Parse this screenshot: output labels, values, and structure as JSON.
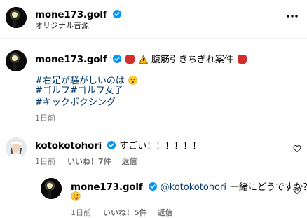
{
  "header": {
    "username": "mone173.golf",
    "audio_label": "オリジナル音源",
    "more_icon": "more-horizontal-icon"
  },
  "caption": {
    "username": "mone173.golf",
    "text": "腹筋引きちぎれ案件",
    "hashtags": [
      "#右足が騒がしいのは",
      "#ゴルフ#ゴルフ女子",
      "#キックボクシング"
    ],
    "time": "1日前"
  },
  "comments": [
    {
      "username": "kotokotohori",
      "text": "すごい！！！！！！",
      "time": "1日前",
      "likes": "いいね！7件",
      "reply_label": "返信"
    }
  ],
  "reply": {
    "username": "mone173.golf",
    "mention": "@kotokotohori",
    "text": "一緒にどうですか？",
    "time": "1日前",
    "likes": "いいね！5件",
    "reply_label": "返信"
  },
  "colors": {
    "verified_blue": "#0095f6",
    "link": "#00376b",
    "muted": "#737373"
  }
}
